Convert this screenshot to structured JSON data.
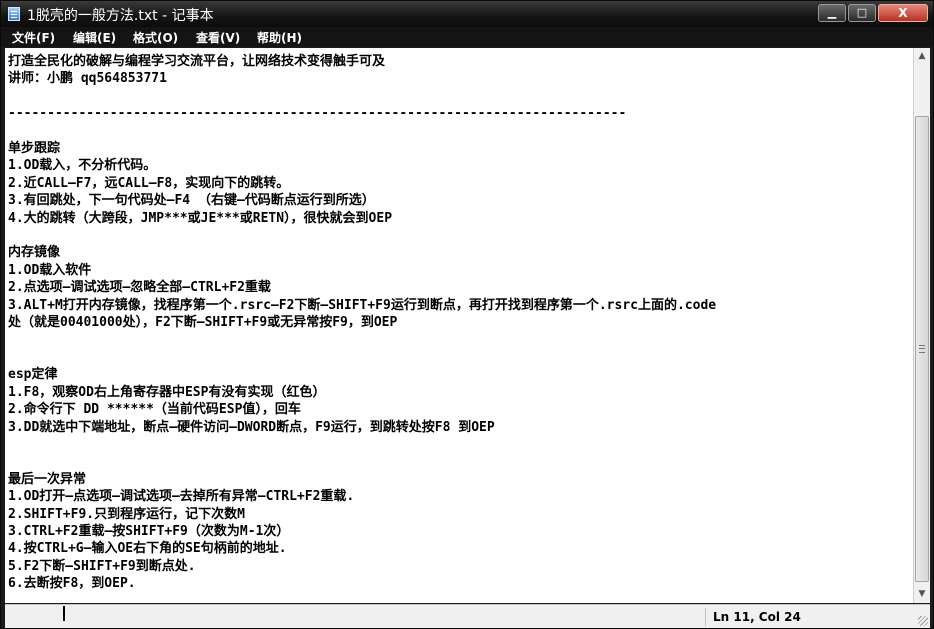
{
  "window": {
    "title": "1脱壳的一般方法.txt - 记事本",
    "minimize_glyph": "▁",
    "maximize_glyph": "□",
    "close_glyph": "X"
  },
  "menu": {
    "file": "文件(F)",
    "edit": "编辑(E)",
    "format": "格式(O)",
    "view": "查看(V)",
    "help": "帮助(H)"
  },
  "document": {
    "lines": [
      "打造全民化的破解与编程学习交流平台，让网络技术变得触手可及",
      "讲师：小鹏 qq564853771",
      "",
      "-------------------------------------------------------------------------------",
      "",
      "单步跟踪",
      "1.OD载入，不分析代码。",
      "2.近CALL—F7，远CALL—F8，实现向下的跳转。",
      "3.有回跳处，下一句代码处—F4 （右键—代码断点运行到所选）",
      "4.大的跳转（大跨段，JMP***或JE***或RETN），很快就会到OEP",
      "",
      "内存镜像",
      "1.OD载入软件",
      "2.点选项—调试选项—忽略全部—CTRL+F2重载",
      "3.ALT+M打开内存镜像，找程序第一个.rsrc—F2下断—SHIFT+F9运行到断点，再打开找到程序第一个.rsrc上面的.code",
      "处（就是00401000处），F2下断—SHIFT+F9或无异常按F9，到OEP",
      "",
      "",
      "esp定律",
      "1.F8，观察OD右上角寄存器中ESP有没有实现（红色）",
      "2.命令行下 DD ******（当前代码ESP值），回车",
      "3.DD就选中下端地址，断点—硬件访问—DWORD断点，F9运行，到跳转处按F8 到OEP",
      "",
      "",
      "最后一次异常",
      "1.OD打开—点选项—调试选项—去掉所有异常—CTRL+F2重载.",
      "2.SHIFT+F9.只到程序运行，记下次数M",
      "3.CTRL+F2重载—按SHIFT+F9（次数为M-1次）",
      "4.按CTRL+G—输入OE右下角的SE句柄前的地址.",
      "5.F2下断—SHIFT+F9到断点处.",
      "6.去断按F8，到OEP."
    ]
  },
  "scrollbar": {
    "up_glyph": "▲",
    "down_glyph": "▼"
  },
  "status": {
    "position": "Ln 11, Col 24"
  }
}
